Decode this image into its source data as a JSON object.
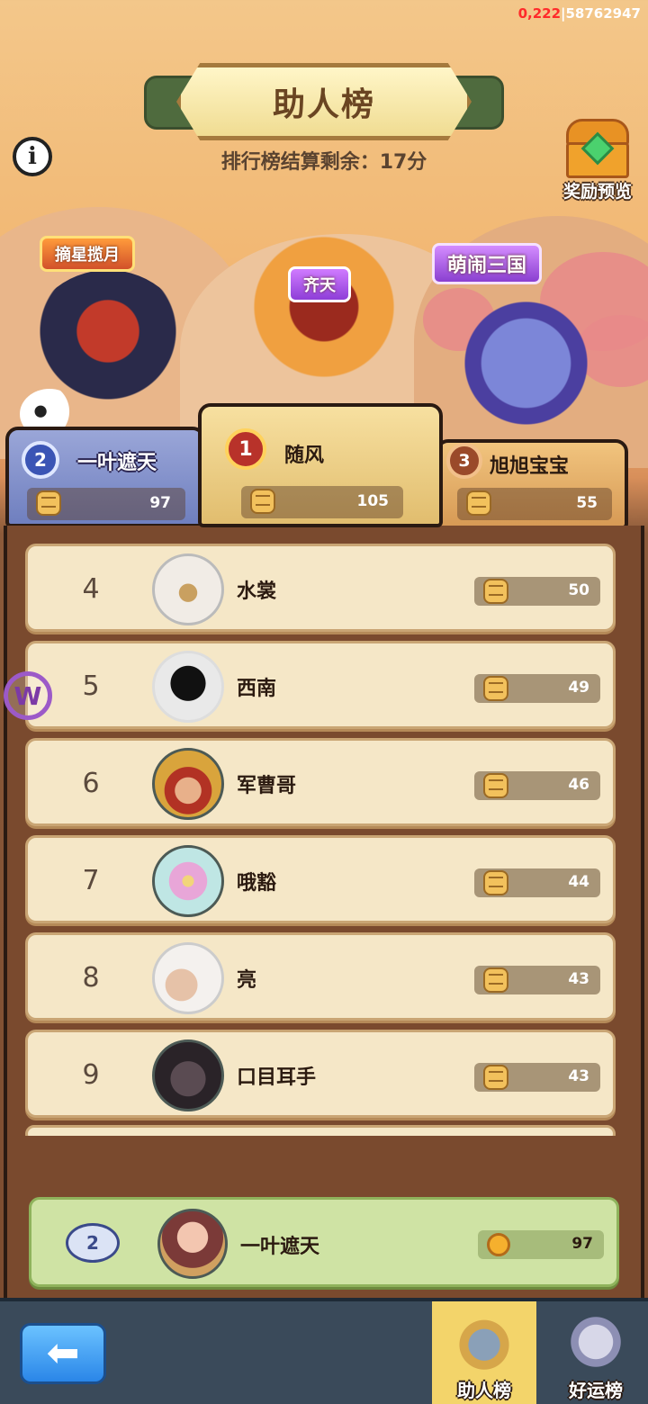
{
  "debug": {
    "highlight": "0,222",
    "rest": "|58762947"
  },
  "title": "助人榜",
  "countdown": "排行榜结算剩余：17分",
  "reward_label": "奖励预览",
  "tags": {
    "left": "摘星揽月",
    "center": "齐天",
    "right": "萌闹三国"
  },
  "podium": {
    "second": {
      "rank": "2",
      "name": "一叶遮天",
      "score": "97"
    },
    "first": {
      "rank": "1",
      "name": "随风",
      "score": "105"
    },
    "third": {
      "rank": "3",
      "name": "旭旭宝宝",
      "score": "55"
    }
  },
  "list": [
    {
      "rank": "4",
      "name": "水裳",
      "score": "50"
    },
    {
      "rank": "5",
      "name": "西南",
      "score": "49"
    },
    {
      "rank": "6",
      "name": "军曹哥",
      "score": "46"
    },
    {
      "rank": "7",
      "name": "哦豁",
      "score": "44"
    },
    {
      "rank": "8",
      "name": "亮",
      "score": "43"
    },
    {
      "rank": "9",
      "name": "口目耳手",
      "score": "43"
    }
  ],
  "my_rank": {
    "rank": "2",
    "name": "一叶遮天",
    "score": "97"
  },
  "side_badge": "W",
  "tabs": {
    "help": "助人榜",
    "luck": "好运榜"
  },
  "icons": [
    "info-icon",
    "treasure-chest-icon",
    "fist-icon",
    "medal-icon",
    "back-arrow-icon",
    "help-rank-icon",
    "luck-rank-icon"
  ]
}
